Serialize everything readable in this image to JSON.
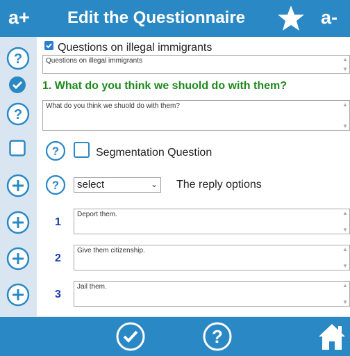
{
  "header": {
    "increase_font": "a+",
    "title": "Edit the Questionnaire",
    "decrease_font": "a-"
  },
  "questionnaire": {
    "title_checked": true,
    "title_label": "Questions on illegal immigrants",
    "title_value": "Questions on illegal immigrants"
  },
  "question": {
    "heading": "1. What do you think we shuold do with them?",
    "text_value": "What do you think we shuold do with them?",
    "segmentation_label": "Segmentation Question",
    "segmentation_checked": false,
    "select_value": "select",
    "reply_options_label": "The reply options"
  },
  "options": [
    {
      "number": "1",
      "value": "Deport  them."
    },
    {
      "number": "2",
      "value": "Give them citizenship."
    },
    {
      "number": "3",
      "value": "Jail them."
    }
  ],
  "icons": {
    "header_right": "star-icon",
    "sidebar": [
      "help-icon",
      "check-circle-icon",
      "help-icon",
      "square-checkbox-icon",
      "plus-circle-icon",
      "plus-circle-icon",
      "plus-circle-icon",
      "plus-circle-icon"
    ],
    "footer": [
      "check-circle-icon",
      "help-icon",
      "home-icon"
    ]
  },
  "colors": {
    "primary": "#2a88c5",
    "sidebar_bg": "#d9e6f2",
    "question_green": "#1e8a1e",
    "number_blue": "#1a3ea8"
  }
}
